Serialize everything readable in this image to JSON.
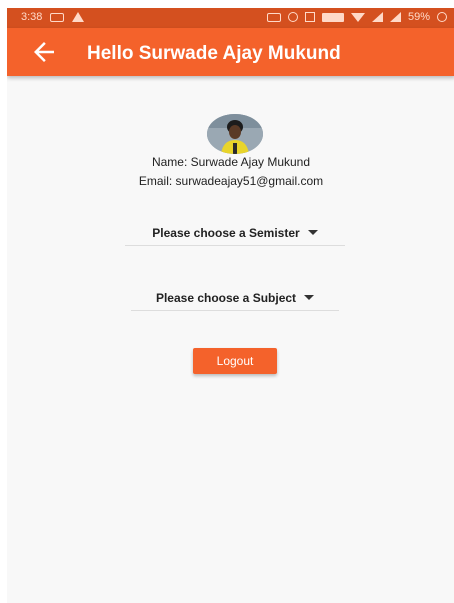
{
  "status_bar": {
    "time": "3:38",
    "battery": "59%"
  },
  "app_bar": {
    "title": "Hello Surwade Ajay Mukund"
  },
  "profile": {
    "name": "Name: Surwade Ajay Mukund",
    "email": "Email: surwadeajay51@gmail.com"
  },
  "semester_dropdown": {
    "value": "Please choose a Semister"
  },
  "subject_dropdown": {
    "value": "Please choose a Subject"
  },
  "logout_label": "Logout",
  "colors": {
    "primary": "#f4622b",
    "status_bar": "#d4501f",
    "background": "#f8f8f8",
    "text": "#222222"
  },
  "icons": {
    "back": "arrow-left-icon",
    "dropdown": "caret-down-icon"
  }
}
